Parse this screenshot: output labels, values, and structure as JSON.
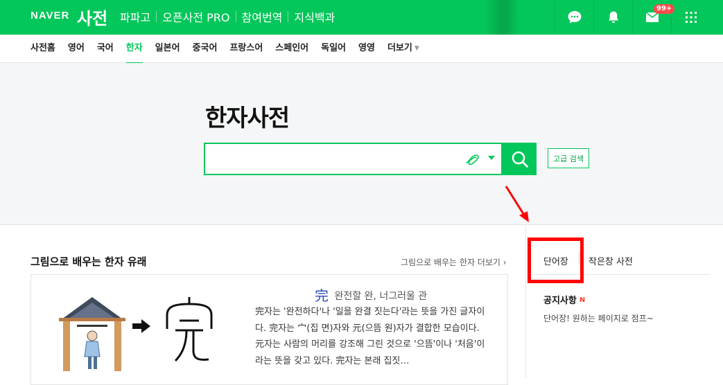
{
  "header": {
    "brand": "NAVER",
    "service": "사전",
    "nav": [
      "파파고",
      "오픈사전 PRO",
      "참여번역",
      "지식백과"
    ],
    "icons": [
      "talk-icon",
      "bell-icon",
      "mail-icon",
      "apps-grid-icon"
    ],
    "mail_badge": "99+",
    "accent": "#03c75a"
  },
  "subnav": {
    "items": [
      "사전홈",
      "영어",
      "국어",
      "한자",
      "일본어",
      "중국어",
      "프랑스어",
      "스페인어",
      "독일어",
      "영영",
      "더보기"
    ],
    "active": "한자"
  },
  "hero": {
    "title": "한자사전",
    "search_value": "",
    "advanced_search": "고급 검색"
  },
  "left": {
    "section_title": "그림으로 배우는 한자 유래",
    "more_link": "그림으로 배우는 한자 더보기",
    "hanzi": "完",
    "hanzi_meaning": "완전할 완, 너그러울 관",
    "description": "完자는 '완전하다'나 '일을 완결 짓는다'라는 뜻을 가진 글자이다. 完자는 宀(집 면)자와 元(으뜸 원)자가 결합한 모습이다. 元자는 사람의 머리를 강조해 그린 것으로 '으뜸'이나 '처음'이라는 뜻을 갖고 있다. 完자는 본래 집짓…"
  },
  "right": {
    "tabs": [
      "단어장",
      "작은창 사전"
    ],
    "notice_title": "공지사항",
    "notice_badge": "N",
    "notice_text": "단어장! 원하는 페이지로 점프~"
  }
}
